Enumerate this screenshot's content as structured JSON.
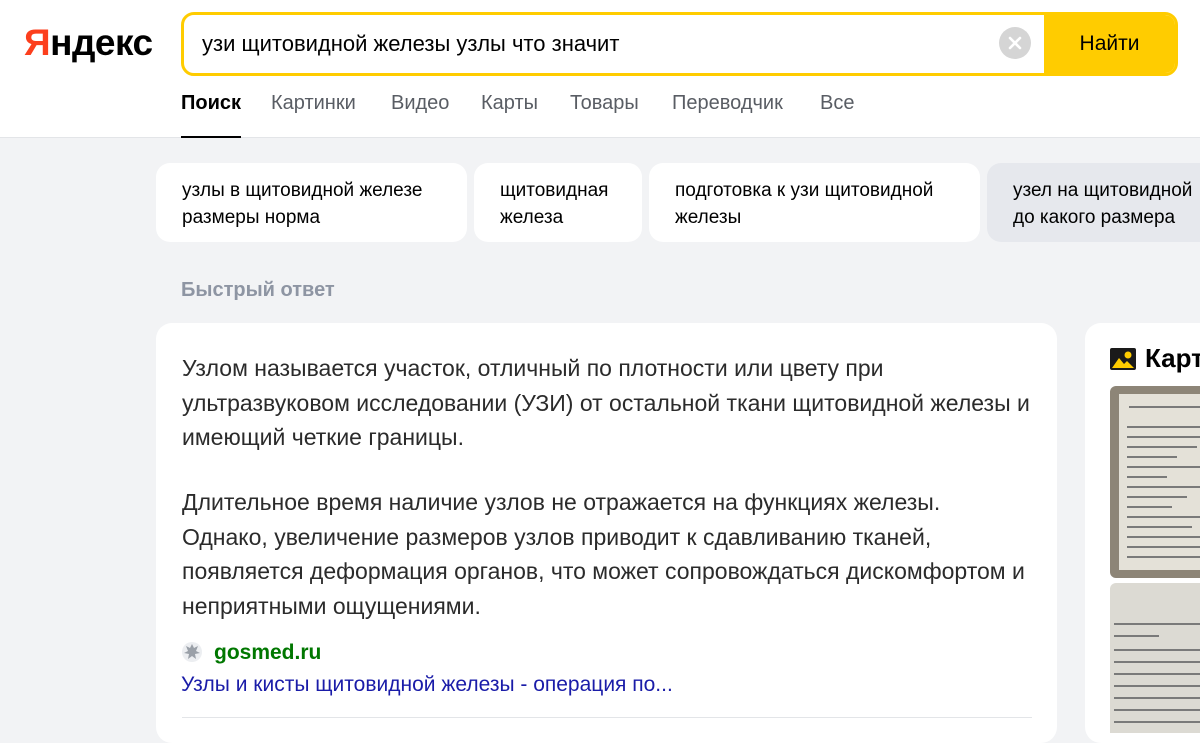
{
  "logo": {
    "first": "Я",
    "rest": "ндекс"
  },
  "search": {
    "query": "узи щитовидной железы узлы что значит",
    "submit_label": "Найти"
  },
  "tabs": [
    {
      "label": "Поиск",
      "active": true
    },
    {
      "label": "Картинки"
    },
    {
      "label": "Видео"
    },
    {
      "label": "Карты"
    },
    {
      "label": "Товары"
    },
    {
      "label": "Переводчик"
    },
    {
      "label": "Все"
    }
  ],
  "suggestions": [
    {
      "line1": "узлы в щитовидной железе",
      "line2": "размеры норма"
    },
    {
      "line1": "щитовидная",
      "line2": "железа"
    },
    {
      "line1": "подготовка к узи щитовидной",
      "line2": "железы"
    },
    {
      "line1": "узел на щитовидной",
      "line2": "до какого размера"
    }
  ],
  "quick_answer": {
    "title": "Быстрый ответ",
    "paragraphs": [
      "Узлом называется участок, отличный по плотности или цвету при ультразвуковом исследовании (УЗИ) от остальной ткани щитовидной железы и имеющий четкие границы.",
      "Длительное время наличие узлов не отражается на функциях железы. Однако, увеличение размеров узлов приводит к сдавливанию тканей, появляется деформация органов, что может сопровождаться дискомфортом и неприятными ощущениями."
    ],
    "source": {
      "host": "gosmed.ru",
      "link": "Узлы и кисты щитовидной железы - операция по..."
    }
  },
  "images_panel": {
    "title": "Картинки"
  },
  "colors": {
    "brand_red": "#fc3f1d",
    "search_yellow": "#ffcc00",
    "source_green": "#007700",
    "link_blue": "#1a1ca8"
  }
}
